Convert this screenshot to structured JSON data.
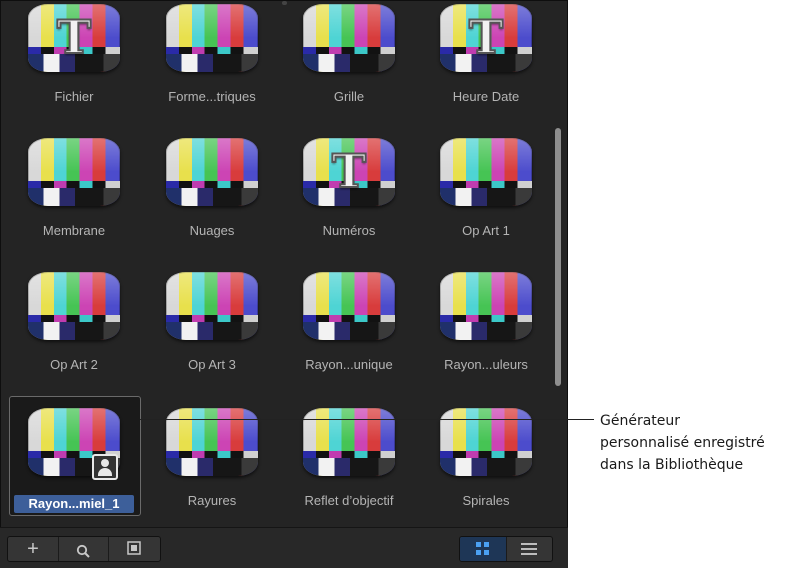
{
  "items": [
    {
      "label": "Fichier",
      "text_overlay": "T",
      "selected": false,
      "custom": false
    },
    {
      "label": "Forme...triques",
      "text_overlay": "",
      "selected": false,
      "custom": false
    },
    {
      "label": "Grille",
      "text_overlay": "",
      "selected": false,
      "custom": false
    },
    {
      "label": "Heure Date",
      "text_overlay": "T",
      "selected": false,
      "custom": false
    },
    {
      "label": "Membrane",
      "text_overlay": "",
      "selected": false,
      "custom": false
    },
    {
      "label": "Nuages",
      "text_overlay": "",
      "selected": false,
      "custom": false
    },
    {
      "label": "Numéros",
      "text_overlay": "T",
      "selected": false,
      "custom": false
    },
    {
      "label": "Op Art 1",
      "text_overlay": "",
      "selected": false,
      "custom": false
    },
    {
      "label": "Op Art 2",
      "text_overlay": "",
      "selected": false,
      "custom": false
    },
    {
      "label": "Op Art 3",
      "text_overlay": "",
      "selected": false,
      "custom": false
    },
    {
      "label": "Rayon...unique",
      "text_overlay": "",
      "selected": false,
      "custom": false
    },
    {
      "label": "Rayon...uleurs",
      "text_overlay": "",
      "selected": false,
      "custom": false
    },
    {
      "label": "Rayon...miel_1",
      "text_overlay": "",
      "selected": true,
      "custom": true
    },
    {
      "label": "Rayures",
      "text_overlay": "",
      "selected": false,
      "custom": false
    },
    {
      "label": "Reflet d’objectif",
      "text_overlay": "",
      "selected": false,
      "custom": false
    },
    {
      "label": "Spirales",
      "text_overlay": "",
      "selected": false,
      "custom": false
    }
  ],
  "toolbar": {
    "add_glyph": "+",
    "search_glyph": "⚲",
    "icon_view_active": true
  },
  "callout": {
    "lines": [
      "Générateur",
      "personnalisé enregistré",
      "dans la Bibliothèque"
    ]
  },
  "colors": {
    "panel_bg": "#242424",
    "selection": "#3d5f9a",
    "active_toggle": "#4ba0f2"
  }
}
